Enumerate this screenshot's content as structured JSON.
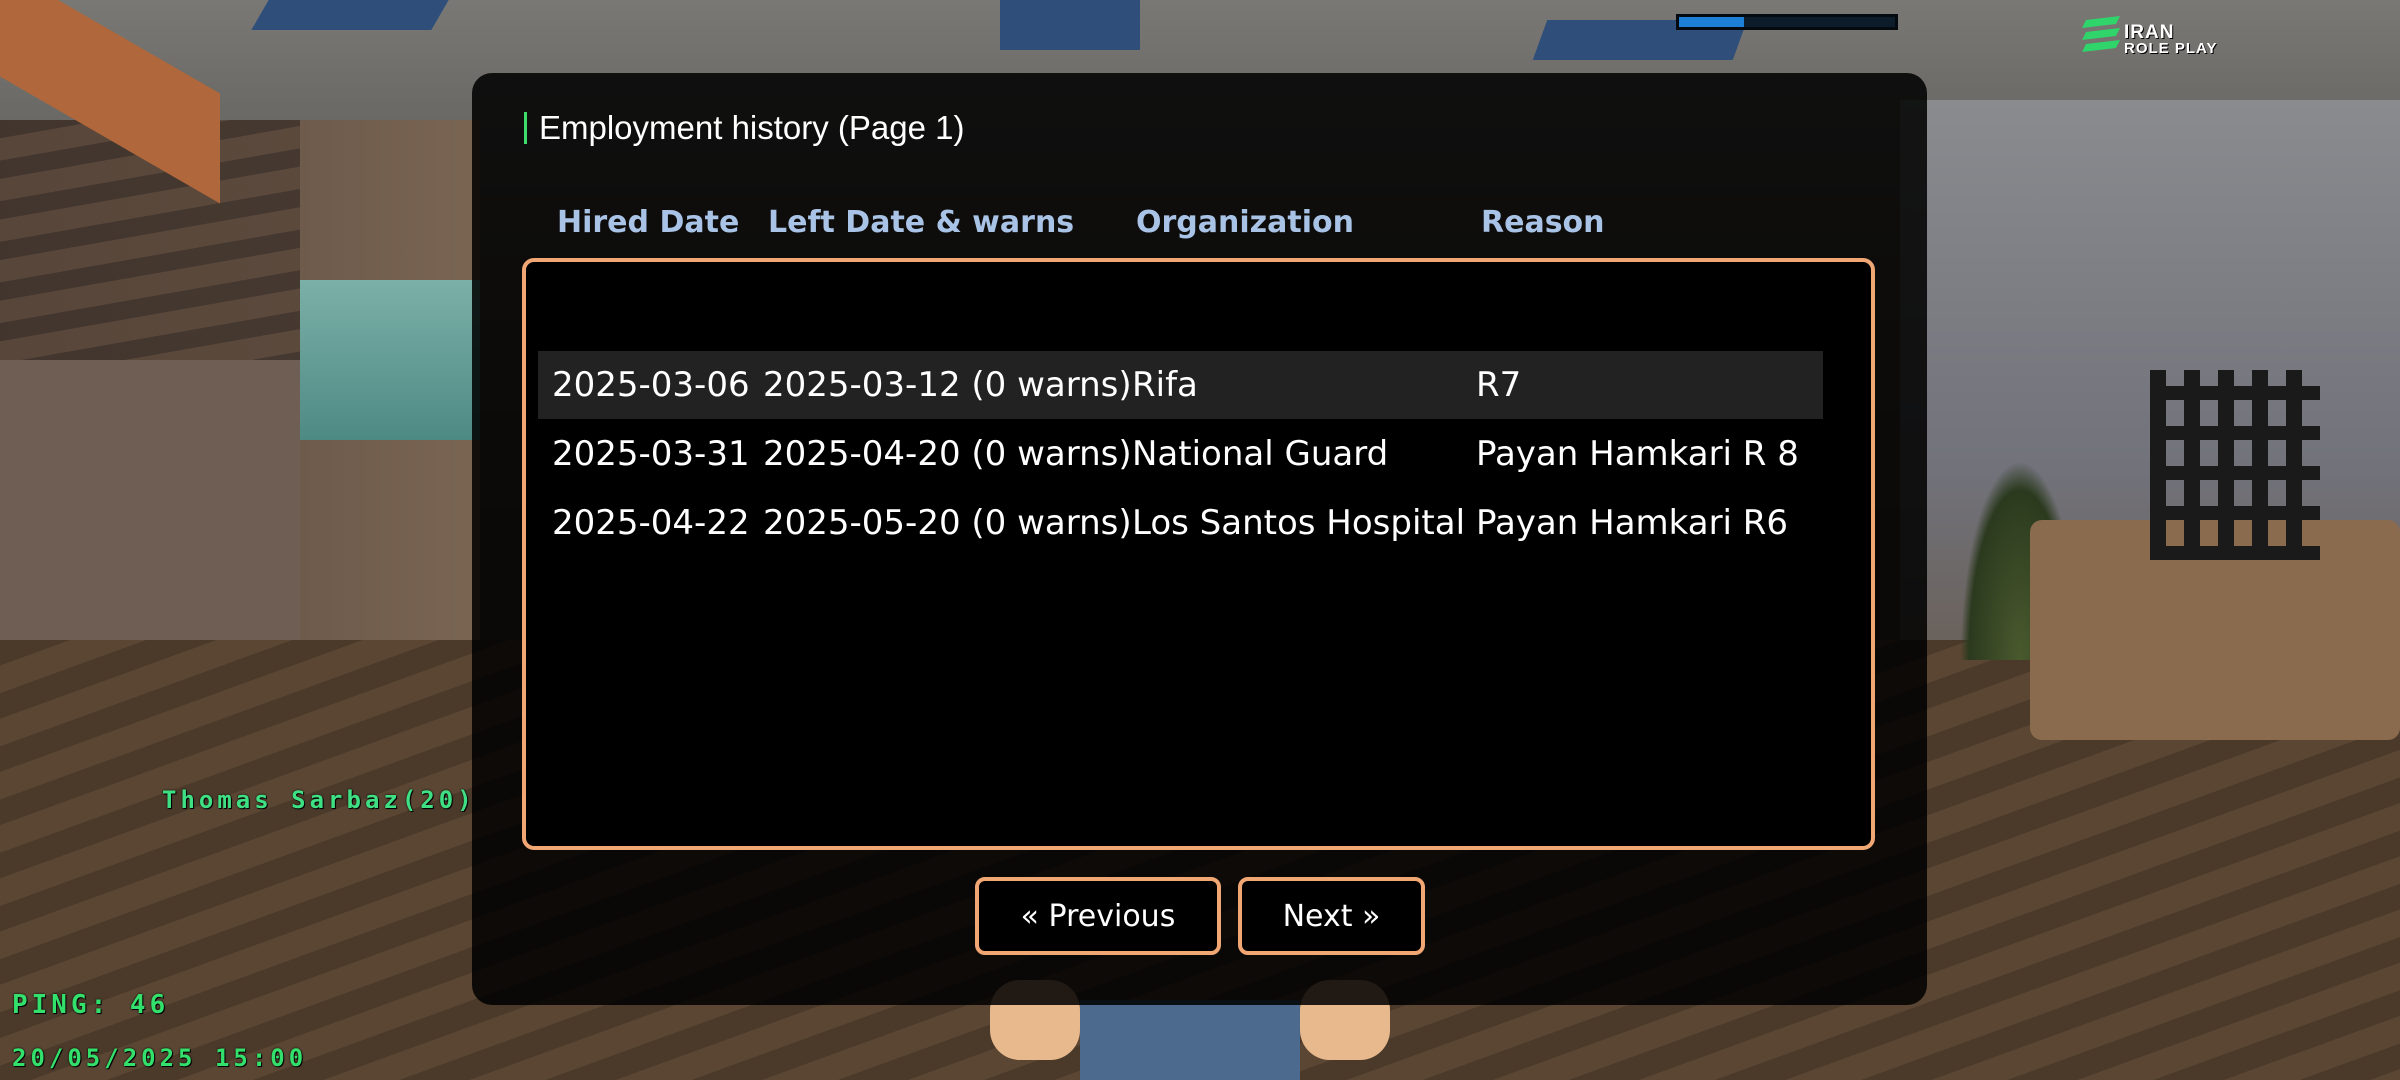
{
  "hud": {
    "nametag": "Thomas Sarbaz(20)",
    "ping": "PING: 46",
    "datetime": "20/05/2025 15:00",
    "progress": 0.3
  },
  "logo": {
    "line1": "IRAN",
    "line2": "ROLE PLAY"
  },
  "dialog": {
    "title": "Employment history (Page 1)",
    "columns": [
      "Hired Date",
      "Left Date & warns",
      "Organization",
      "Reason"
    ],
    "rows": [
      {
        "hired": "2025-03-06",
        "left": "2025-03-12 (0 warns)",
        "org": "Rifa",
        "reason": "R7",
        "selected": true
      },
      {
        "hired": "2025-03-31",
        "left": "2025-04-20 (0 warns)",
        "org": "National Guard",
        "reason": "Payan Hamkari R 8",
        "selected": false
      },
      {
        "hired": "2025-04-22",
        "left": "2025-05-20 (0 warns)",
        "org": "Los Santos Hospital",
        "reason": "Payan Hamkari R6",
        "selected": false
      }
    ],
    "buttons": {
      "previous": "« Previous",
      "next": "Next »"
    }
  },
  "colors": {
    "accent_border": "#f0a774",
    "header_text": "#a9c3e6",
    "hud_green": "#33e06b",
    "title_accent": "#3ddc6b"
  }
}
